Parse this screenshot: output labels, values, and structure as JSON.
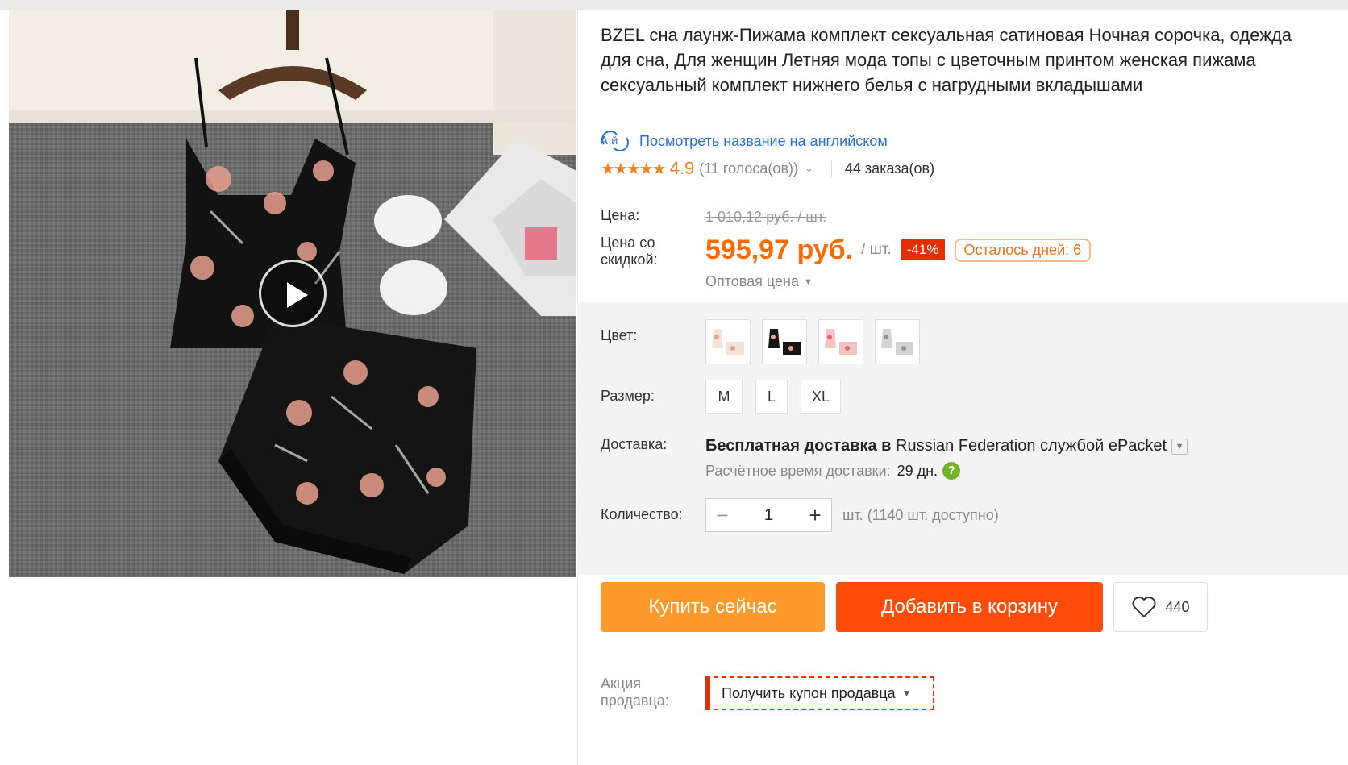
{
  "product": {
    "title": "BZEL сна лаунж-Пижама комплект сексуальная сатиновая Ночная сорочка, одежда для сна, Для женщин Летняя мода топы с цветочным принтом женская пижама сексуальный комплект нижнего белья с нагрудными вкладышами",
    "translate_link": "Посмотреть название на английском",
    "translate_icon_text": "A й",
    "rating": {
      "stars": "★★★★★",
      "value": "4.9",
      "votes": "(11 голоса(ов))",
      "orders": "44 заказа(ов)"
    }
  },
  "pricing": {
    "price_label": "Цена:",
    "old_price": "1 010,12 руб. / шт.",
    "discount_label": "Цена со скидкой:",
    "price": "595,97 руб.",
    "unit": "/ шт.",
    "discount_badge": "-41%",
    "days_left": "Осталось дней: 6",
    "wholesale": "Оптовая цена"
  },
  "options": {
    "color_label": "Цвет:",
    "colors": [
      "white-floral",
      "black-floral",
      "pink-floral",
      "grey-floral"
    ],
    "size_label": "Размер:",
    "sizes": [
      "M",
      "L",
      "XL"
    ]
  },
  "shipping": {
    "label": "Доставка:",
    "free_text": "Бесплатная доставка в",
    "destination": "Russian Federation службой ePacket",
    "estimate_label": "Расчётное время доставки:",
    "estimate_days": "29 дн.",
    "help_symbol": "?"
  },
  "quantity": {
    "label": "Количество:",
    "value": "1",
    "available": "шт. (1140 шт. доступно)"
  },
  "actions": {
    "buy_now": "Купить сейчас",
    "add_to_cart": "Добавить в корзину",
    "wishlist_count": "440"
  },
  "promo": {
    "label": "Акция продавца:",
    "coupon": "Получить купон продавца"
  },
  "colors": {
    "accent_orange": "#ff6a00",
    "buy_now_bg": "#fe9a2b",
    "add_cart_bg": "#ff4c0a",
    "discount_red": "#e62e04",
    "link_blue": "#2b6fd1",
    "help_green": "#70b62a"
  }
}
